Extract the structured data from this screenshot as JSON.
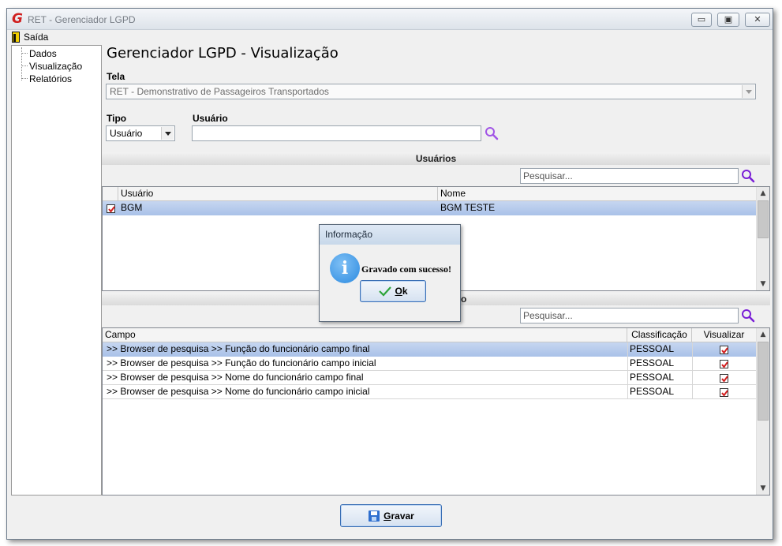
{
  "window": {
    "title": "RET - Gerenciador LGPD",
    "controls": {
      "minimize": "▭",
      "maximize": "▣",
      "close": "✕"
    }
  },
  "menu": {
    "exit_label": "Saída"
  },
  "tree": {
    "items": [
      "Dados",
      "Visualização",
      "Relatórios"
    ]
  },
  "page": {
    "heading": "Gerenciador LGPD - Visualização"
  },
  "form": {
    "tela_label": "Tela",
    "tela_value": "RET -  Demonstrativo de Passageiros Transportados",
    "tipo_label": "Tipo",
    "tipo_value": "Usuário",
    "usuario_label": "Usuário",
    "usuario_value": ""
  },
  "users_section": {
    "title": "Usuários",
    "search_placeholder": "Pesquisar...",
    "columns": [
      "Usuário",
      "Nome"
    ],
    "rows": [
      {
        "checked": true,
        "usuario": "BGM",
        "nome": "BGM TESTE"
      }
    ]
  },
  "fields_section": {
    "title_visible_fragment": "o",
    "search_placeholder": "Pesquisar...",
    "columns": [
      "Campo",
      "Classificação",
      "Visualizar"
    ],
    "rows": [
      {
        "campo": ">> Browser de pesquisa >> Função do funcionário campo final",
        "classificacao": "PESSOAL",
        "visualizar": true
      },
      {
        "campo": ">> Browser de pesquisa >> Função do funcionário campo inicial",
        "classificacao": "PESSOAL",
        "visualizar": true
      },
      {
        "campo": ">> Browser de pesquisa >> Nome do funcionário campo final",
        "classificacao": "PESSOAL",
        "visualizar": true
      },
      {
        "campo": ">> Browser de pesquisa >> Nome do funcionário campo inicial",
        "classificacao": "PESSOAL",
        "visualizar": true
      }
    ]
  },
  "save_button": {
    "label_first": "G",
    "label_rest": "ravar"
  },
  "dialog": {
    "title": "Informação",
    "icon": "info-icon",
    "message": "Gravado com sucesso!",
    "ok_first": "O",
    "ok_rest": "k"
  },
  "colors": {
    "selected_row": "#b7cbeb",
    "checkmark": "#d31f1f",
    "search_icon": "#8a2be2",
    "brand_red": "#d02020"
  }
}
